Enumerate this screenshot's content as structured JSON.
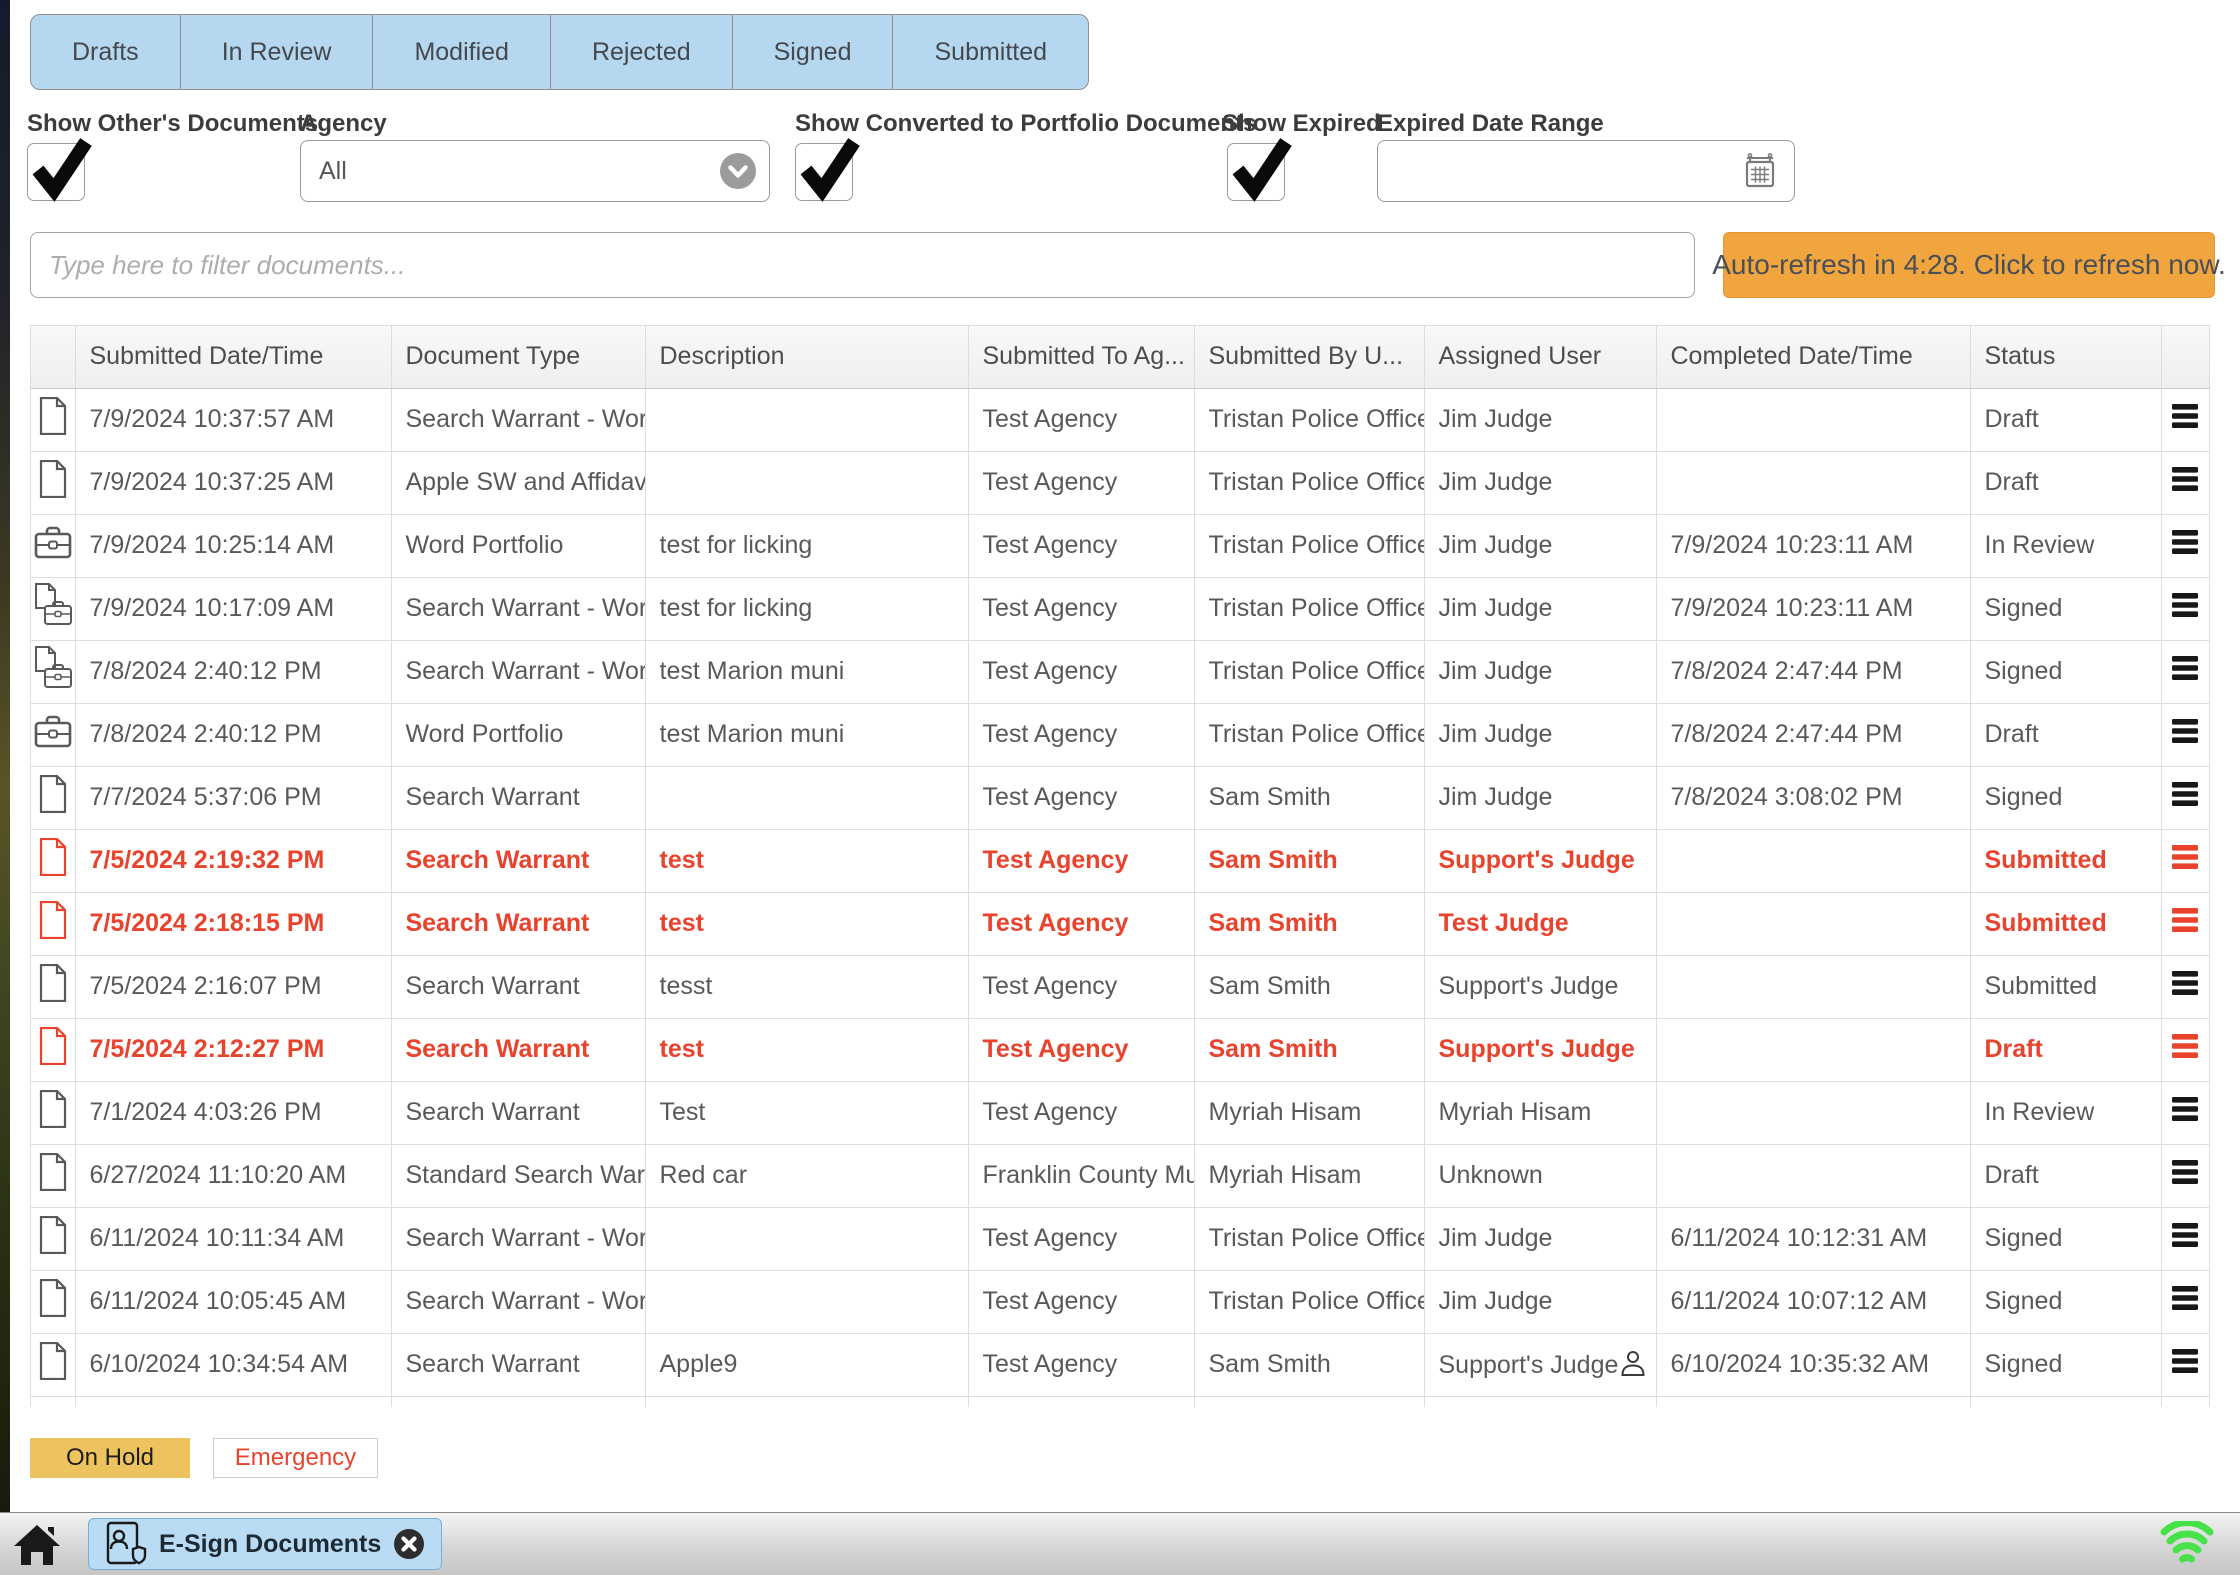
{
  "tabs": [
    "Drafts",
    "In Review",
    "Modified",
    "Rejected",
    "Signed",
    "Submitted"
  ],
  "filters": {
    "show_others_label": "Show Other's Documents",
    "agency_label": "Agency",
    "agency_value": "All",
    "show_converted_label": "Show Converted to Portfolio Documents",
    "show_expired_label": "Show Expired",
    "expired_range_label": "Expired Date Range",
    "expired_range_value": "",
    "show_others_checked": true,
    "show_converted_checked": true,
    "show_expired_checked": true,
    "filter_placeholder": "Type here to filter documents...",
    "refresh_label": "Auto-refresh in 4:28. Click to refresh now."
  },
  "table": {
    "columns": [
      "",
      "Submitted Date/Time",
      "Document Type",
      "Description",
      "Submitted To Ag...",
      "Submitted By U...",
      "Assigned User",
      "Completed Date/Time",
      "Status",
      ""
    ],
    "rows": [
      {
        "icon": "document",
        "submitted": "7/9/2024 10:37:57 AM",
        "doc_type": "Search Warrant - Wor",
        "description": "",
        "submitted_to": "Test Agency",
        "submitted_by": "Tristan Police Office",
        "assigned_user": "Jim Judge",
        "completed": "",
        "status": "Draft",
        "red": false,
        "assigned_user_icon": false
      },
      {
        "icon": "document",
        "submitted": "7/9/2024 10:37:25 AM",
        "doc_type": "Apple SW and Affidav",
        "description": "",
        "submitted_to": "Test Agency",
        "submitted_by": "Tristan Police Office",
        "assigned_user": "Jim Judge",
        "completed": "",
        "status": "Draft",
        "red": false,
        "assigned_user_icon": false
      },
      {
        "icon": "portfolio",
        "submitted": "7/9/2024 10:25:14 AM",
        "doc_type": "Word Portfolio",
        "description": "test for licking",
        "submitted_to": "Test Agency",
        "submitted_by": "Tristan Police Office",
        "assigned_user": "Jim Judge",
        "completed": "7/9/2024 10:23:11 AM",
        "status": "In Review",
        "red": false,
        "assigned_user_icon": false
      },
      {
        "icon": "document-portfolio",
        "submitted": "7/9/2024 10:17:09 AM",
        "doc_type": "Search Warrant - Wor",
        "description": "test for licking",
        "submitted_to": "Test Agency",
        "submitted_by": "Tristan Police Office",
        "assigned_user": "Jim Judge",
        "completed": "7/9/2024 10:23:11 AM",
        "status": "Signed",
        "red": false,
        "assigned_user_icon": false
      },
      {
        "icon": "document-portfolio",
        "submitted": "7/8/2024 2:40:12 PM",
        "doc_type": "Search Warrant - Wor",
        "description": "test Marion muni",
        "submitted_to": "Test Agency",
        "submitted_by": "Tristan Police Office",
        "assigned_user": "Jim Judge",
        "completed": "7/8/2024 2:47:44 PM",
        "status": "Signed",
        "red": false,
        "assigned_user_icon": false
      },
      {
        "icon": "portfolio",
        "submitted": "7/8/2024 2:40:12 PM",
        "doc_type": "Word Portfolio",
        "description": "test Marion muni",
        "submitted_to": "Test Agency",
        "submitted_by": "Tristan Police Office",
        "assigned_user": "Jim Judge",
        "completed": "7/8/2024 2:47:44 PM",
        "status": "Draft",
        "red": false,
        "assigned_user_icon": false
      },
      {
        "icon": "document",
        "submitted": "7/7/2024 5:37:06 PM",
        "doc_type": "Search Warrant",
        "description": "",
        "submitted_to": "Test Agency",
        "submitted_by": "Sam Smith",
        "assigned_user": "Jim Judge",
        "completed": "7/8/2024 3:08:02 PM",
        "status": "Signed",
        "red": false,
        "assigned_user_icon": false
      },
      {
        "icon": "document",
        "submitted": "7/5/2024 2:19:32 PM",
        "doc_type": "Search Warrant",
        "description": "test",
        "submitted_to": "Test Agency",
        "submitted_by": "Sam Smith",
        "assigned_user": "Support's Judge",
        "completed": "",
        "status": "Submitted",
        "red": true,
        "assigned_user_icon": false
      },
      {
        "icon": "document",
        "submitted": "7/5/2024 2:18:15 PM",
        "doc_type": "Search Warrant",
        "description": "test",
        "submitted_to": "Test Agency",
        "submitted_by": "Sam Smith",
        "assigned_user": "Test Judge",
        "completed": "",
        "status": "Submitted",
        "red": true,
        "assigned_user_icon": false
      },
      {
        "icon": "document",
        "submitted": "7/5/2024 2:16:07 PM",
        "doc_type": "Search Warrant",
        "description": "tesst",
        "submitted_to": "Test Agency",
        "submitted_by": "Sam Smith",
        "assigned_user": "Support's Judge",
        "completed": "",
        "status": "Submitted",
        "red": false,
        "assigned_user_icon": false
      },
      {
        "icon": "document",
        "submitted": "7/5/2024 2:12:27 PM",
        "doc_type": "Search Warrant",
        "description": "test",
        "submitted_to": "Test Agency",
        "submitted_by": "Sam Smith",
        "assigned_user": "Support's Judge",
        "completed": "",
        "status": "Draft",
        "red": true,
        "assigned_user_icon": false
      },
      {
        "icon": "document",
        "submitted": "7/1/2024 4:03:26 PM",
        "doc_type": "Search Warrant",
        "description": "Test",
        "submitted_to": "Test Agency",
        "submitted_by": "Myriah Hisam",
        "assigned_user": "Myriah Hisam",
        "completed": "",
        "status": "In Review",
        "red": false,
        "assigned_user_icon": false
      },
      {
        "icon": "document",
        "submitted": "6/27/2024 11:10:20 AM",
        "doc_type": "Standard Search War",
        "description": "Red car",
        "submitted_to": "Franklin County Mu",
        "submitted_by": "Myriah Hisam",
        "assigned_user": "Unknown",
        "completed": "",
        "status": "Draft",
        "red": false,
        "assigned_user_icon": false
      },
      {
        "icon": "document",
        "submitted": "6/11/2024 10:11:34 AM",
        "doc_type": "Search Warrant - Wor",
        "description": "",
        "submitted_to": "Test Agency",
        "submitted_by": "Tristan Police Office",
        "assigned_user": "Jim Judge",
        "completed": "6/11/2024 10:12:31 AM",
        "status": "Signed",
        "red": false,
        "assigned_user_icon": false
      },
      {
        "icon": "document",
        "submitted": "6/11/2024 10:05:45 AM",
        "doc_type": "Search Warrant - Wor",
        "description": "",
        "submitted_to": "Test Agency",
        "submitted_by": "Tristan Police Office",
        "assigned_user": "Jim Judge",
        "completed": "6/11/2024 10:07:12 AM",
        "status": "Signed",
        "red": false,
        "assigned_user_icon": false
      },
      {
        "icon": "document",
        "submitted": "6/10/2024 10:34:54 AM",
        "doc_type": "Search Warrant",
        "description": "Apple9",
        "submitted_to": "Test Agency",
        "submitted_by": "Sam Smith",
        "assigned_user": "Support's Judge",
        "completed": "6/10/2024 10:35:32 AM",
        "status": "Signed",
        "red": false,
        "assigned_user_icon": true
      }
    ]
  },
  "legend": {
    "on_hold": "On Hold",
    "emergency": "Emergency"
  },
  "taskbar": {
    "tab_label": "E-Sign Documents"
  },
  "colors": {
    "tab_blue": "#b5d7ef",
    "refresh_orange": "#f0a53e",
    "alert_red": "#e8432d",
    "on_hold_yellow": "#ecc35c",
    "wifi_green": "#47e247"
  }
}
